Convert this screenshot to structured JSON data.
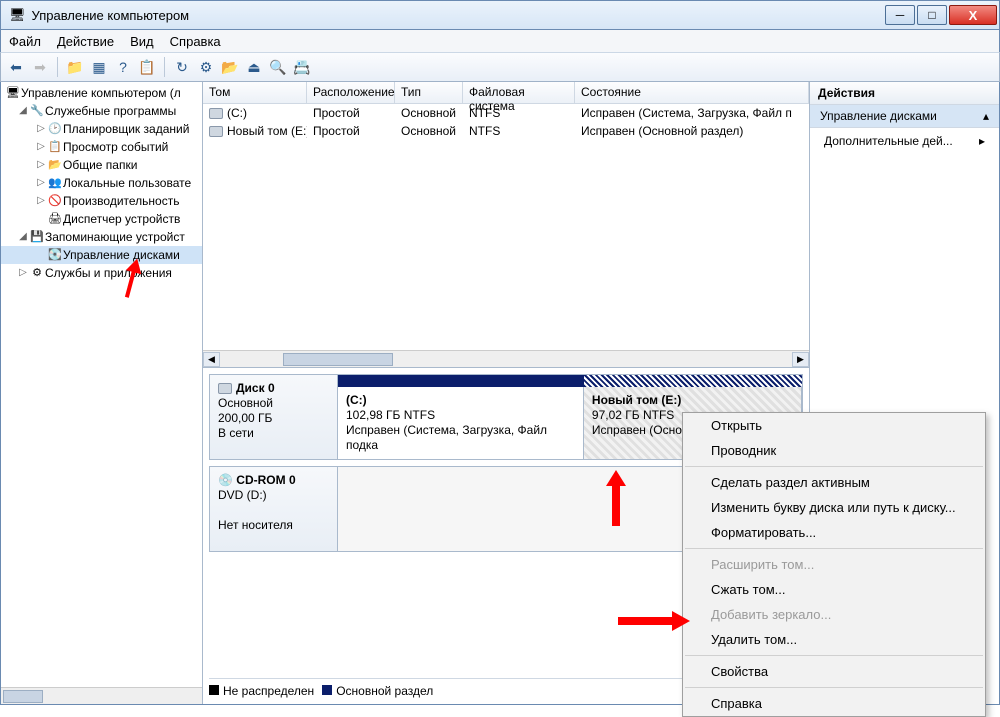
{
  "window": {
    "title": "Управление компьютером"
  },
  "menu": {
    "file": "Файл",
    "action": "Действие",
    "view": "Вид",
    "help": "Справка"
  },
  "tree": {
    "root": "Управление компьютером (л",
    "group1": "Служебные программы",
    "i_task": "Планировщик заданий",
    "i_event": "Просмотр событий",
    "i_shared": "Общие папки",
    "i_users": "Локальные пользовате",
    "i_perf": "Производительность",
    "i_devmgr": "Диспетчер устройств",
    "group2": "Запоминающие устройст",
    "i_disk": "Управление дисками",
    "group3": "Службы и приложения"
  },
  "list": {
    "cols": {
      "vol": "Том",
      "layout": "Расположение",
      "type": "Тип",
      "fs": "Файловая система",
      "status": "Состояние"
    },
    "widths": {
      "vol": 104,
      "layout": 88,
      "type": 68,
      "fs": 112,
      "status": 220
    },
    "rows": [
      {
        "vol": "(C:)",
        "layout": "Простой",
        "type": "Основной",
        "fs": "NTFS",
        "status": "Исправен (Система, Загрузка, Файл п"
      },
      {
        "vol": "Новый том (E:)",
        "layout": "Простой",
        "type": "Основной",
        "fs": "NTFS",
        "status": "Исправен (Основной раздел)"
      }
    ]
  },
  "disk0": {
    "name": "Диск 0",
    "type": "Основной",
    "size": "200,00 ГБ",
    "state": "В сети",
    "p1": {
      "name": "(C:)",
      "size": "102,98 ГБ NTFS",
      "status": "Исправен (Система, Загрузка, Файл подка"
    },
    "p2": {
      "name": "Новый том  (E:)",
      "size": "97,02 ГБ NTFS",
      "status": "Исправен (Основной"
    }
  },
  "cdrom": {
    "name": "CD-ROM 0",
    "type": "DVD (D:)",
    "state": "Нет носителя"
  },
  "legend": {
    "unalloc": "Не распределен",
    "primary": "Основной раздел"
  },
  "actions": {
    "title": "Действия",
    "section": "Управление дисками",
    "more": "Дополнительные дей..."
  },
  "context": {
    "open": "Открыть",
    "explorer": "Проводник",
    "active": "Сделать раздел активным",
    "change_letter": "Изменить букву диска или путь к диску...",
    "format": "Форматировать...",
    "extend": "Расширить том...",
    "shrink": "Сжать том...",
    "mirror": "Добавить зеркало...",
    "delete": "Удалить том...",
    "props": "Свойства",
    "help": "Справка"
  }
}
